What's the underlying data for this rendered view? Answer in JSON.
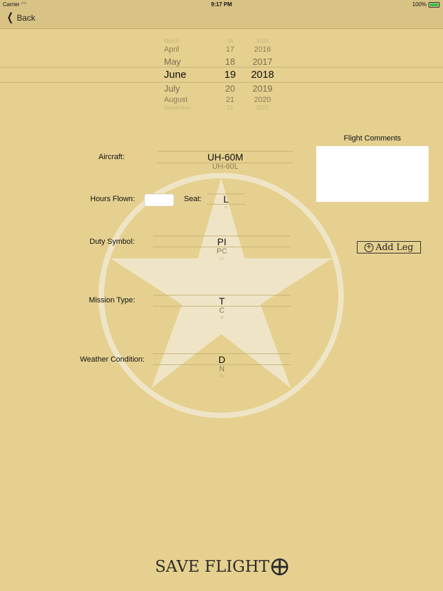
{
  "status_bar": {
    "carrier": "Carrier",
    "time": "9:17 PM",
    "battery": "100%",
    "battery_level": 1.0
  },
  "nav": {
    "back_label": "Back"
  },
  "date_picker": {
    "months": [
      "March",
      "April",
      "May",
      "June",
      "July",
      "August",
      "September"
    ],
    "days": [
      "16",
      "17",
      "18",
      "19",
      "20",
      "21",
      "22"
    ],
    "years": [
      "2015",
      "2016",
      "2017",
      "2018",
      "2019",
      "2020",
      "2021"
    ],
    "selected": {
      "month": "June",
      "day": "19",
      "year": "2018"
    }
  },
  "form": {
    "aircraft": {
      "label": "Aircraft:",
      "selected": "UH-60M",
      "next": "UH-60L"
    },
    "hours_flown": {
      "label": "Hours Flown:",
      "value": ""
    },
    "seat": {
      "label": "Seat:",
      "selected": "L",
      "next": "R"
    },
    "duty_symbol": {
      "label": "Duty Symbol:",
      "selected": "PI",
      "next": "PC",
      "faint": "UT"
    },
    "mission_type": {
      "label": "Mission Type:",
      "selected": "T",
      "next": "C",
      "faint": "M"
    },
    "weather": {
      "label": "Weather Condition:",
      "selected": "D",
      "next": "N",
      "faint": "NG"
    }
  },
  "comments": {
    "label": "Flight Comments",
    "value": ""
  },
  "buttons": {
    "add_leg": "Add Leg",
    "save": "SAVE FLIGHT"
  },
  "colors": {
    "background": "#e5d08f",
    "navbar": "#d8c284",
    "emblem": "#efe5c6"
  }
}
